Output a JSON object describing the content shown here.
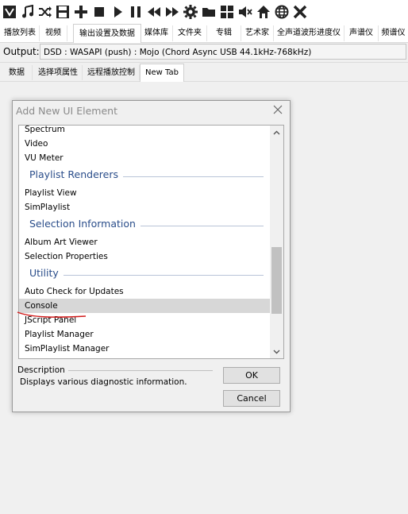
{
  "toolbar": {
    "icons": [
      "app-logo-icon",
      "music-note-icon",
      "shuffle-icon",
      "save-icon",
      "add-icon",
      "stop-icon",
      "play-icon",
      "pause-icon",
      "previous-icon",
      "next-icon",
      "settings-icon",
      "folder-icon",
      "grid-icon",
      "mute-icon",
      "home-icon",
      "globe-icon",
      "close-icon"
    ]
  },
  "tabs_top": [
    "播放列表",
    "视频",
    "输出设置及数据",
    "媒体库",
    "文件夹",
    "专辑",
    "艺术家",
    "全声道波形进度仪",
    "声谱仪",
    "频谱仪"
  ],
  "tabs_top_active": 2,
  "output": {
    "label": "Output:",
    "value": "DSD : WASAPI (push) : Mojo (Chord Async USB 44.1kHz-768kHz)"
  },
  "tabs_sub": [
    "数据",
    "选择项属性",
    "远程播放控制",
    "New Tab"
  ],
  "tabs_sub_active": 3,
  "dialog": {
    "title": "Add New UI Element",
    "list": {
      "spectrum": "Spectrum",
      "video": "Video",
      "vu_meter": "VU Meter",
      "group_playlist_renderers": "Playlist Renderers",
      "playlist_view": "Playlist View",
      "simplaylist": "SimPlaylist",
      "group_selection_information": "Selection Information",
      "album_art_viewer": "Album Art Viewer",
      "selection_properties": "Selection Properties",
      "group_utility": "Utility",
      "auto_check_for_updates": "Auto Check for Updates",
      "console": "Console",
      "jscript_panel": "JScript Panel",
      "playlist_manager": "Playlist Manager",
      "simplaylist_manager": "SimPlaylist Manager"
    },
    "selected_item": "Console",
    "description_label": "Description",
    "description_text": "Displays various diagnostic information.",
    "ok_label": "OK",
    "cancel_label": "Cancel"
  }
}
